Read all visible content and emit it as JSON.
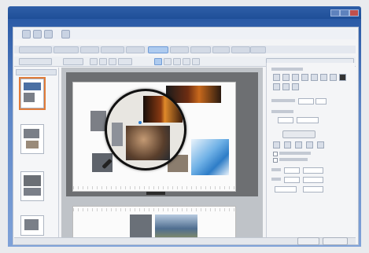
{
  "window": {
    "title": ""
  },
  "toolbar": {
    "tabs": [
      "",
      "",
      "",
      "",
      "",
      "",
      "",
      "",
      "",
      "",
      ""
    ]
  },
  "pages_panel": {
    "page_count": 4,
    "selected_index": 0
  },
  "properties_panel": {
    "title": ""
  },
  "dialog": {
    "ok_label": "",
    "cancel_label": ""
  },
  "colors": {
    "window_frame": "#2a5aa6",
    "accent": "#e07b39",
    "selection": "#aecbef",
    "magnifier_ring": "#111111"
  },
  "icons": [
    "magnifier-icon",
    "pin-icon",
    "save-icon",
    "undo-icon",
    "redo-icon",
    "print-icon"
  ]
}
